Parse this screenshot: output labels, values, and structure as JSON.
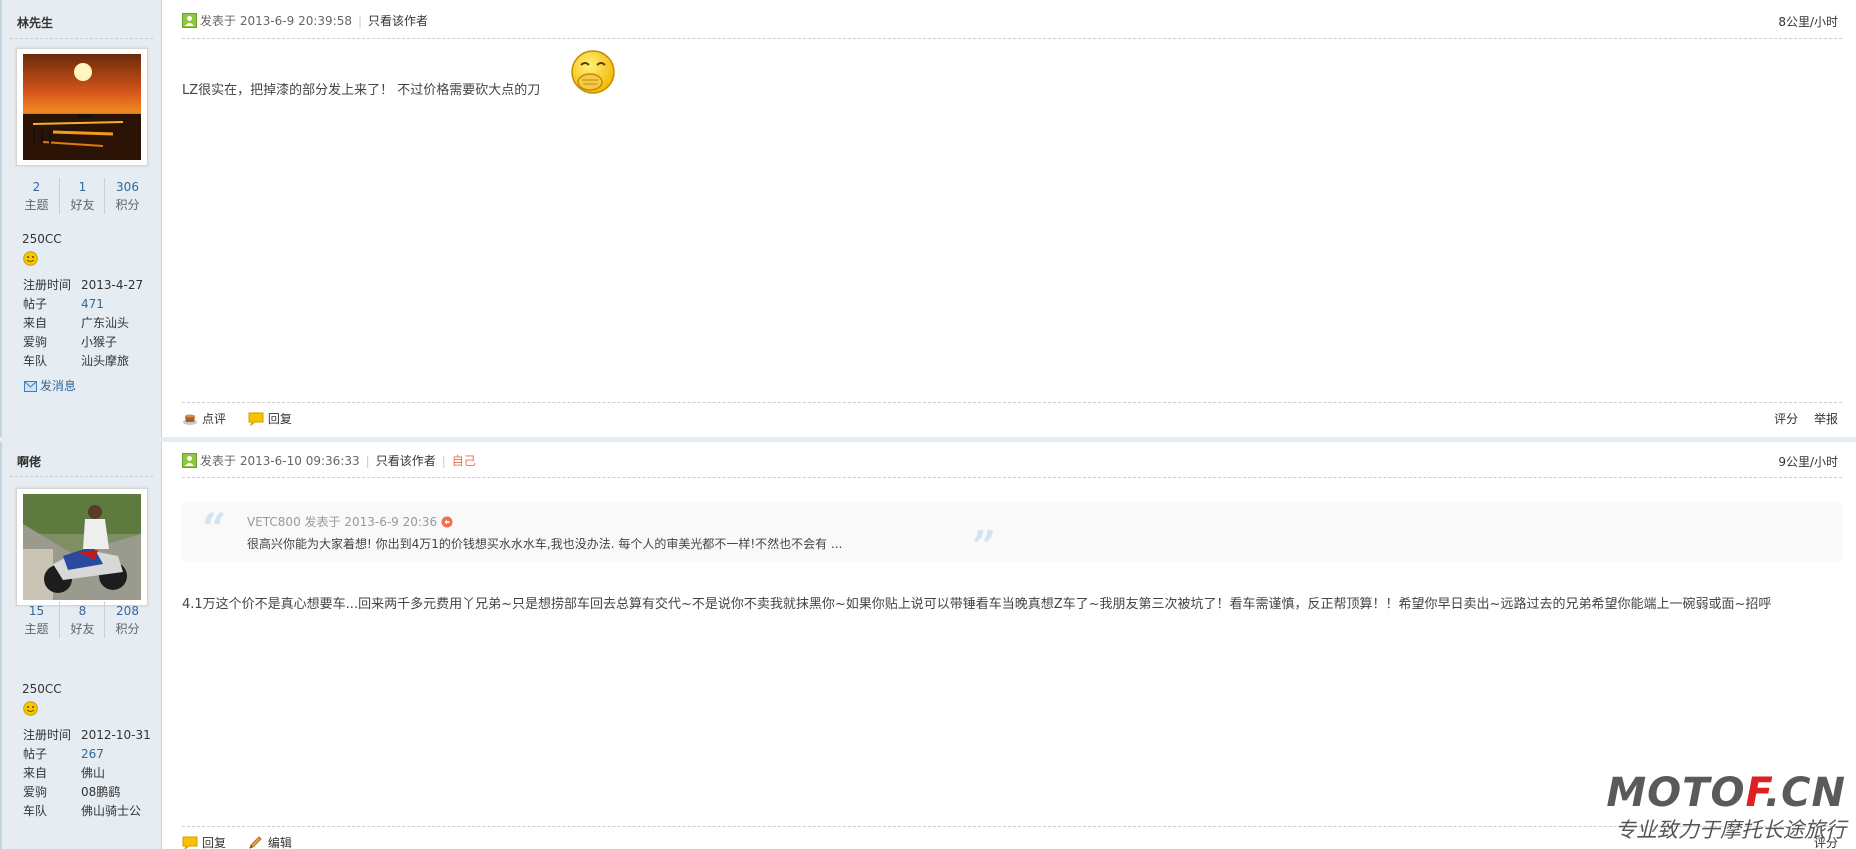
{
  "posts": [
    {
      "author": "林先生",
      "stats": [
        {
          "num": "2",
          "label": "主题"
        },
        {
          "num": "1",
          "label": "好友"
        },
        {
          "num": "306",
          "label": "积分"
        }
      ],
      "level": "250CC",
      "profile": [
        {
          "key": "注册时间",
          "value": "2013-4-27"
        },
        {
          "key": "帖子",
          "value": "471"
        },
        {
          "key": "来自",
          "value": "广东汕头"
        },
        {
          "key": "爱驹",
          "value": "小猴子"
        },
        {
          "key": "车队",
          "value": "汕头摩旅"
        }
      ],
      "send_message": "发消息",
      "posted_at": "发表于 2013-6-9 20:39:58",
      "only_author": "只看该作者",
      "floor": "8公里/小时",
      "content": "LZ很实在，把掉漆的部分发上来了！ 不过价格需要砍大点的刀",
      "actions": [
        "点评",
        "回复"
      ],
      "right_actions": [
        "评分",
        "举报"
      ]
    },
    {
      "author": "啊佬",
      "stats": [
        {
          "num": "15",
          "label": "主题"
        },
        {
          "num": "8",
          "label": "好友"
        },
        {
          "num": "208",
          "label": "积分"
        }
      ],
      "level": "250CC",
      "profile": [
        {
          "key": "注册时间",
          "value": "2012-10-31"
        },
        {
          "key": "帖子",
          "value": "267"
        },
        {
          "key": "来自",
          "value": "佛山"
        },
        {
          "key": "爱驹",
          "value": "08鹏鹞"
        },
        {
          "key": "车队",
          "value": "佛山骑士公"
        }
      ],
      "posted_at": "发表于 2013-6-10 09:36:33",
      "only_author": "只看该作者",
      "self_label": "自己",
      "floor": "9公里/小时",
      "quote": {
        "author": "VETC800 发表于 2013-6-9 20:36",
        "text": "很高兴你能为大家着想! 你出到4万1的价钱想买水水水车,我也没办法. 每个人的审美光都不一样!不然也不会有 ..."
      },
      "content": "4.1万这个价不是真心想要车...回来两千多元费用丫兄弟~只是想捞部车回去总算有交代~不是说你不卖我就抹黑你~如果你贴上说可以带锤看车当晚真想Z车了~我朋友第三次被坑了！看车需谨慎，反正帮顶算！！希望你早日卖出~远路过去的兄弟希望你能端上一碗弱或面~招呼",
      "actions": [
        "回复",
        "编辑"
      ],
      "right_actions": [
        "评分"
      ]
    }
  ],
  "watermark": {
    "brand_left": "MOTO",
    "brand_red": "F",
    "brand_right": ".CN",
    "slogan": "专业致力于摩托长途旅行"
  },
  "colors": {
    "sidebar_bg": "#E5EDF2",
    "border": "#C2D5E3",
    "link": "#336699",
    "self_label": "#F26C4F"
  }
}
